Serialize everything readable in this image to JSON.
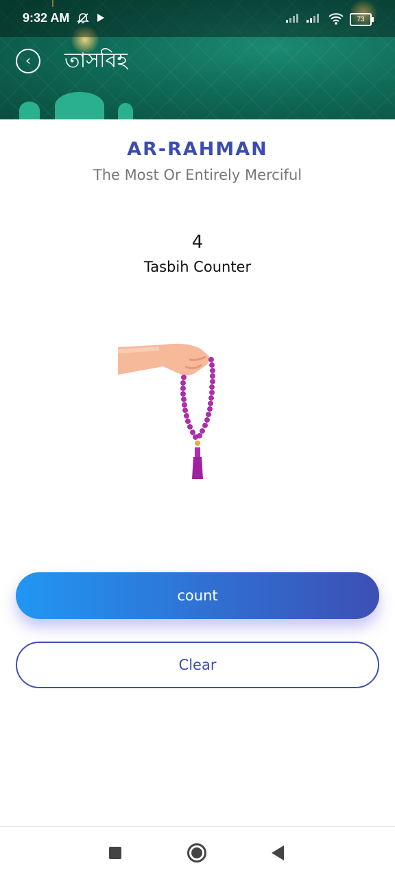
{
  "status_bar": {
    "time": "9:32 AM",
    "mute_icon": "bell-off-icon",
    "app_icon": "play-icon",
    "signal_icons": [
      "signal-icon",
      "signal-icon"
    ],
    "wifi_icon": "wifi-icon",
    "battery": "73"
  },
  "header": {
    "back_icon": "chevron-left-icon",
    "title": "তাসবিহ"
  },
  "main": {
    "name_title": "AR-RAHMAN",
    "name_meaning": "The Most Or Entirely Merciful",
    "count_value": "4",
    "count_label": "Tasbih Counter",
    "illustration": "tasbih-hand-illustration"
  },
  "actions": {
    "count_label": "count",
    "clear_label": "Clear"
  },
  "colors": {
    "accent": "#3d4fb5",
    "gradient_start": "#2196f3",
    "header_green": "#0f6b57",
    "beads": "#b42bb3"
  },
  "nav_bar": {
    "items": [
      "square-icon",
      "home-circle-icon",
      "back-triangle-icon"
    ]
  }
}
